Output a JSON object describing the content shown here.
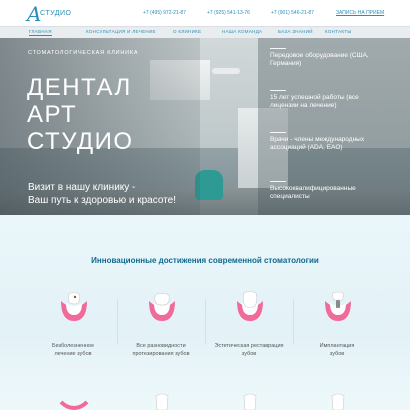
{
  "header": {
    "logo_text": "СТУДИО",
    "phones": [
      "+7 (495) 972-21-87",
      "+7 (925) 541-13-76",
      "+7 (901) 546-21-87"
    ],
    "signup": "ЗАПИСЬ НА ПРИЕМ"
  },
  "nav": {
    "items": [
      "ГЛАВНАЯ",
      "КОНСУЛЬТАЦИЯ И ЛЕЧЕНИЕ",
      "О КЛИНИКЕ",
      "НАША КОМАНДА",
      "БАЗА ЗНАНИЙ",
      "КОНТАКТЫ"
    ],
    "active_index": 0
  },
  "hero": {
    "clinic_label": "СТОМАТОЛОГИЧЕСКАЯ КЛИНИКА",
    "title_line1": "ДЕНТАЛ",
    "title_line2": "АРТ",
    "title_line3": "СТУДИО",
    "subtitle_line1": "Визит в нашу клинику -",
    "subtitle_line2": "Ваш путь к здоровью и красоте!",
    "features": [
      "Передовое оборудование (США, Германия)",
      "15 лет успешной работы (все лицензии на лечение)",
      "Врачи - члены международных ассоциаций (ADA, EAO)",
      "Высококвалифицированные специалисты"
    ]
  },
  "innovations": {
    "title": "Инновационные достижения современной стоматологии",
    "items": [
      {
        "caption_line1": "Безболезненное",
        "caption_line2": "лечение зубов",
        "icon": "tooth-treatment-icon"
      },
      {
        "caption_line1": "Все разновидности",
        "caption_line2": "протезирования зубов",
        "icon": "tooth-prosthetics-icon"
      },
      {
        "caption_line1": "Эстетическая реставрация",
        "caption_line2": "зубов",
        "icon": "tooth-restoration-icon"
      },
      {
        "caption_line1": "Имплантация",
        "caption_line2": "зубов",
        "icon": "tooth-implant-icon"
      }
    ]
  },
  "colors": {
    "accent": "#2a8fb8",
    "title_blue": "#0f6a8f",
    "pink": "#f06a9a",
    "teal": "#2e9a94"
  }
}
